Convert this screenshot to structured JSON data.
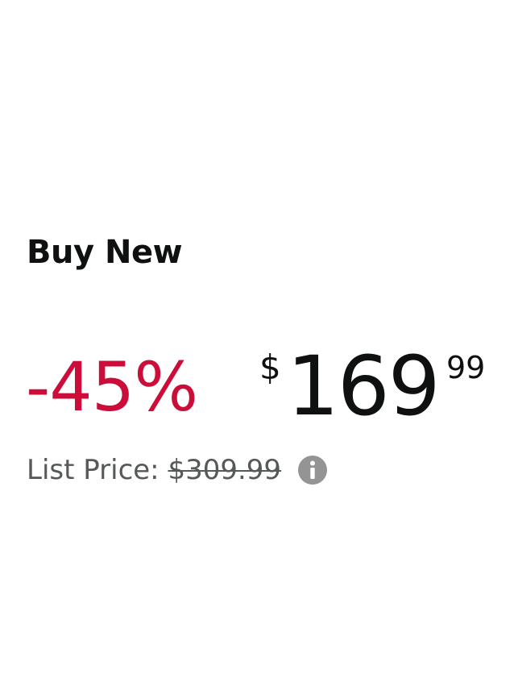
{
  "offer": {
    "heading": "Buy New",
    "discount": "-45%",
    "price": {
      "currency_symbol": "$",
      "whole": "169",
      "fraction": "99"
    },
    "list_price": {
      "label": "List Price:",
      "value": "$309.99"
    },
    "info_icon": "info-circle-icon"
  },
  "colors": {
    "discount": "#cc0c39",
    "price": "#0f1111",
    "list_price": "#565959",
    "info_icon": "#949494"
  }
}
